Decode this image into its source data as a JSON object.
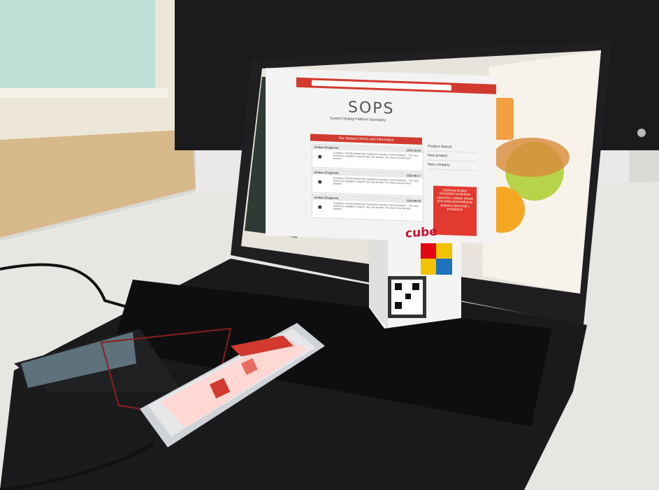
{
  "colors": {
    "wall": "#d9d9d6",
    "desk": "#e6e6e3",
    "window_frame": "#ece7d8",
    "window_glass": "#bfe2d8",
    "wood": "#d8b98c",
    "laptop_body": "#1f1f22",
    "laptop_bezel": "#111113",
    "key": "#0c0c0e",
    "app_red": "#d23a2f",
    "phone_silver": "#cfd2d6",
    "cube_white": "#f4f4f2",
    "cube_red": "#c8102e"
  },
  "icons": [
    "laptop",
    "keyboard",
    "smartphone",
    "rubik-cube-box",
    "qr-code",
    "usb-cable",
    "monitor"
  ],
  "laptop_screen": {
    "app_title": "SOPS",
    "subtitle": "System Obsługi Platform Sprzedaży",
    "panel_title": "Our Newest Clients and Information",
    "cards": [
      {
        "label": "product (Fragment)",
        "date": "2018-10-04",
        "text": "Company commercialized has registered a product named product'... The new product is available in search, tab, and domain. You have to be the best product'"
      },
      {
        "label": "product (Fragment)",
        "date": "2018-09-17",
        "text": "Company commercialized has registered a product named product'... The new product is available in search, tab, and domain. You have to be the best product'"
      },
      {
        "label": "product (Fragment)",
        "date": "2018-09-03",
        "text": "Company commercialized has registered a product named product'... The new product is available in search, tab, and domain. You have to be the best product'"
      }
    ],
    "side_menu": [
      "Product Search",
      "New product",
      "New company"
    ],
    "promo_text": "Zeskanuj tysiące wszystkich produktów żywności z całego świata pod nową wprowadzenia systemu informacji o produktach"
  },
  "cube_box": {
    "brand": "cube"
  }
}
